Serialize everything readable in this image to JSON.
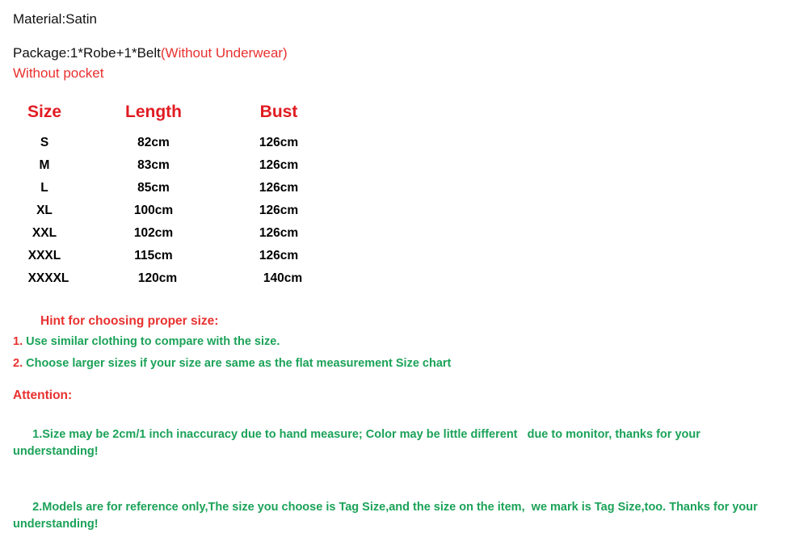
{
  "colors": {
    "red": "#e8312f",
    "header_red": "#e11b22",
    "green": "#1ba258",
    "black": "#000000",
    "background": "#ffffff"
  },
  "intro": {
    "material": "Material:Satin",
    "package_main": "Package:1*Robe+1*Belt",
    "package_note": "(Without Underwear)",
    "pocket_note": "Without pocket"
  },
  "size_chart": {
    "headers": [
      "Size",
      "Length",
      "Bust"
    ],
    "rows": [
      {
        "size": "S",
        "length": "82cm",
        "bust": "126cm"
      },
      {
        "size": "M",
        "length": "83cm",
        "bust": "126cm"
      },
      {
        "size": "L",
        "length": "85cm",
        "bust": "126cm"
      },
      {
        "size": "XL",
        "length": "100cm",
        "bust": "126cm"
      },
      {
        "size": "XXL",
        "length": "102cm",
        "bust": "126cm"
      },
      {
        "size": "XXXL",
        "length": "115cm",
        "bust": "126cm"
      },
      {
        "size": "XXXXL",
        "length": "120cm",
        "bust": "140cm"
      }
    ]
  },
  "hint": {
    "title": "Hint for choosing proper size:",
    "items": [
      {
        "num": "1.",
        "text": " Use similar clothing to compare with the size."
      },
      {
        "num": "2.",
        "text": " Choose larger sizes if your size are same as the flat measurement Size chart"
      }
    ]
  },
  "attention": {
    "title": "Attention:",
    "items": [
      {
        "num": "1.",
        "text": "Size may be 2cm/1 inch inaccuracy due to hand measure; Color may be little different   due to monitor, thanks for your understanding!"
      },
      {
        "num": "2.",
        "text": "Models are for reference only,The size you choose is Tag Size,and the size on the item,  we mark is Tag Size,too. Thanks for your understanding!"
      }
    ]
  }
}
